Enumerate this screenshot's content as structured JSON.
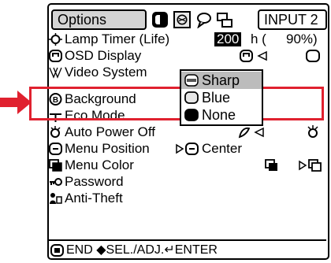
{
  "header": {
    "tab_label": "Options",
    "input_label": "INPUT 2",
    "tab_icons": [
      "picture-icon",
      "fine-sync-icon",
      "speech-icon",
      "network-icon"
    ]
  },
  "menu": {
    "items": [
      {
        "label": "Lamp Timer  (Life)",
        "icon": "lamp-timer-icon"
      },
      {
        "label": "OSD Display",
        "icon": "osd-display-icon"
      },
      {
        "label": "Video System",
        "icon": "video-system-icon"
      },
      {
        "label": "Background",
        "icon": "background-icon"
      },
      {
        "label": "Eco Mode",
        "icon": "eco-mode-icon"
      },
      {
        "label": "Auto Power Off",
        "icon": "auto-power-off-icon"
      },
      {
        "label": "Menu Position",
        "icon": "menu-position-icon"
      },
      {
        "label": "Menu Color",
        "icon": "menu-color-icon"
      },
      {
        "label": "Password",
        "icon": "password-icon"
      },
      {
        "label": "Anti-Theft",
        "icon": "anti-theft-icon"
      }
    ],
    "lamp_hours": "200",
    "lamp_unit": "h (",
    "lamp_percent": "90%)",
    "menu_position_value": "Center"
  },
  "background_popup": {
    "options": [
      {
        "label": "Sharp",
        "icon": "sharp-logo-icon",
        "selected": true
      },
      {
        "label": "Blue",
        "icon": "blue-screen-icon",
        "selected": false
      },
      {
        "label": "None",
        "icon": "black-screen-icon",
        "selected": false
      }
    ]
  },
  "footer": {
    "text": "END ◆SEL./ADJ.↵ENTER"
  },
  "colors": {
    "highlight": "#e0212f",
    "selected_bg": "#bcbcbc"
  }
}
